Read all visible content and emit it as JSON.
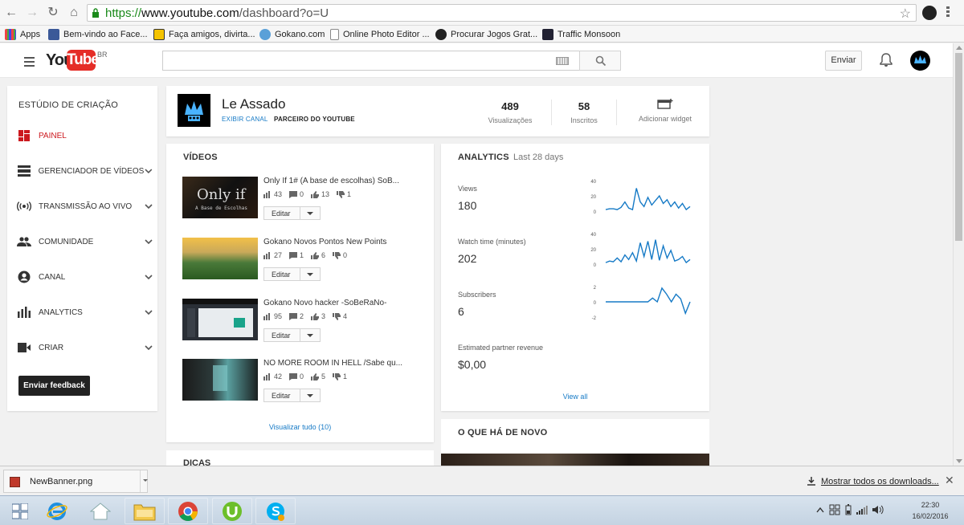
{
  "browser": {
    "url_scheme": "https://",
    "url_host": "www.youtube.com",
    "url_path": "/dashboard?o=U",
    "bookmarks": [
      {
        "label": "Apps"
      },
      {
        "label": "Bem-vindo ao Face..."
      },
      {
        "label": "Faça amigos, divirta..."
      },
      {
        "label": "Gokano.com"
      },
      {
        "label": "Online Photo Editor ..."
      },
      {
        "label": "Procurar Jogos Grat..."
      },
      {
        "label": "Traffic Monsoon"
      }
    ]
  },
  "header": {
    "logo_you": "You",
    "logo_tube": "Tube",
    "logo_region": "BR",
    "search_placeholder": "",
    "upload_label": "Enviar"
  },
  "sidebar": {
    "title": "ESTÚDIO DE CRIAÇÃO",
    "items": [
      {
        "label": "PAINEL",
        "icon": "dashboard-icon"
      },
      {
        "label": "GERENCIADOR DE VÍDEOS",
        "icon": "video-manager-icon"
      },
      {
        "label": "TRANSMISSÃO AO VIVO",
        "icon": "live-icon"
      },
      {
        "label": "COMUNIDADE",
        "icon": "community-icon"
      },
      {
        "label": "CANAL",
        "icon": "channel-icon"
      },
      {
        "label": "ANALYTICS",
        "icon": "analytics-icon"
      },
      {
        "label": "CRIAR",
        "icon": "create-icon"
      }
    ],
    "feedback_label": "Enviar feedback"
  },
  "channel": {
    "name": "Le Assado",
    "view_channel": "EXIBIR CANAL",
    "partner": "PARCEIRO DO YOUTUBE",
    "views_value": "489",
    "views_label": "Visualizações",
    "subs_value": "58",
    "subs_label": "Inscritos",
    "widget_label": "Adicionar widget"
  },
  "videos": {
    "title": "VÍDEOS",
    "edit_label": "Editar",
    "view_all": "Visualizar tudo (10)",
    "items": [
      {
        "title": "Only If 1# (A base de escolhas) SoB...",
        "views": "43",
        "comments": "0",
        "likes": "13",
        "dislikes": "1",
        "thumb_text": "Only if",
        "thumb_sub": "A Base de Escolhas"
      },
      {
        "title": "Gokano Novos Pontos New Points",
        "views": "27",
        "comments": "1",
        "likes": "6",
        "dislikes": "0"
      },
      {
        "title": "Gokano Novo hacker -SoBeRaNo-",
        "views": "95",
        "comments": "2",
        "likes": "3",
        "dislikes": "4"
      },
      {
        "title": "NO MORE ROOM IN HELL /Sabe qu...",
        "views": "42",
        "comments": "0",
        "likes": "5",
        "dislikes": "1"
      }
    ]
  },
  "tips": {
    "title": "DICAS"
  },
  "analytics": {
    "title": "ANALYTICS",
    "period": "Last 28 days",
    "view_all": "View all",
    "metrics": [
      {
        "label": "Views",
        "value": "180"
      },
      {
        "label": "Watch time (minutes)",
        "value": "202"
      },
      {
        "label": "Subscribers",
        "value": "6"
      },
      {
        "label": "Estimated partner revenue",
        "value": "$0,00"
      }
    ]
  },
  "news": {
    "title": "O QUE HÁ DE NOVO"
  },
  "downloads": {
    "file_name": "NewBanner.png",
    "show_all": "Mostrar todos os downloads..."
  },
  "taskbar": {
    "time": "22:30",
    "date": "16/02/2016"
  },
  "colors": {
    "accent_red": "#cc181e",
    "link_blue": "#167ac6",
    "chart_line": "#167ac6"
  },
  "chart_data": [
    {
      "type": "line",
      "title": "Views",
      "ylim": [
        0,
        40
      ],
      "yticks": [
        "40",
        "20",
        "0"
      ],
      "values": [
        2,
        3,
        3,
        2,
        5,
        12,
        4,
        2,
        30,
        12,
        6,
        18,
        8,
        14,
        20,
        10,
        15,
        6,
        12,
        4,
        10,
        2,
        6
      ]
    },
    {
      "type": "line",
      "title": "Watch time (minutes)",
      "ylim": [
        0,
        40
      ],
      "yticks": [
        "40",
        "20",
        "0"
      ],
      "values": [
        2,
        4,
        3,
        8,
        3,
        12,
        6,
        15,
        4,
        28,
        10,
        30,
        6,
        32,
        5,
        24,
        8,
        18,
        4,
        6,
        10,
        2,
        6
      ]
    },
    {
      "type": "line",
      "title": "Subscribers",
      "ylim": [
        -2,
        2
      ],
      "yticks": [
        "2",
        "0",
        "-2"
      ],
      "values": [
        0,
        0,
        0,
        0,
        0,
        0,
        0,
        0,
        0,
        0,
        0.5,
        0,
        1.8,
        1,
        0,
        1,
        0.4,
        -1.5,
        0
      ]
    }
  ]
}
